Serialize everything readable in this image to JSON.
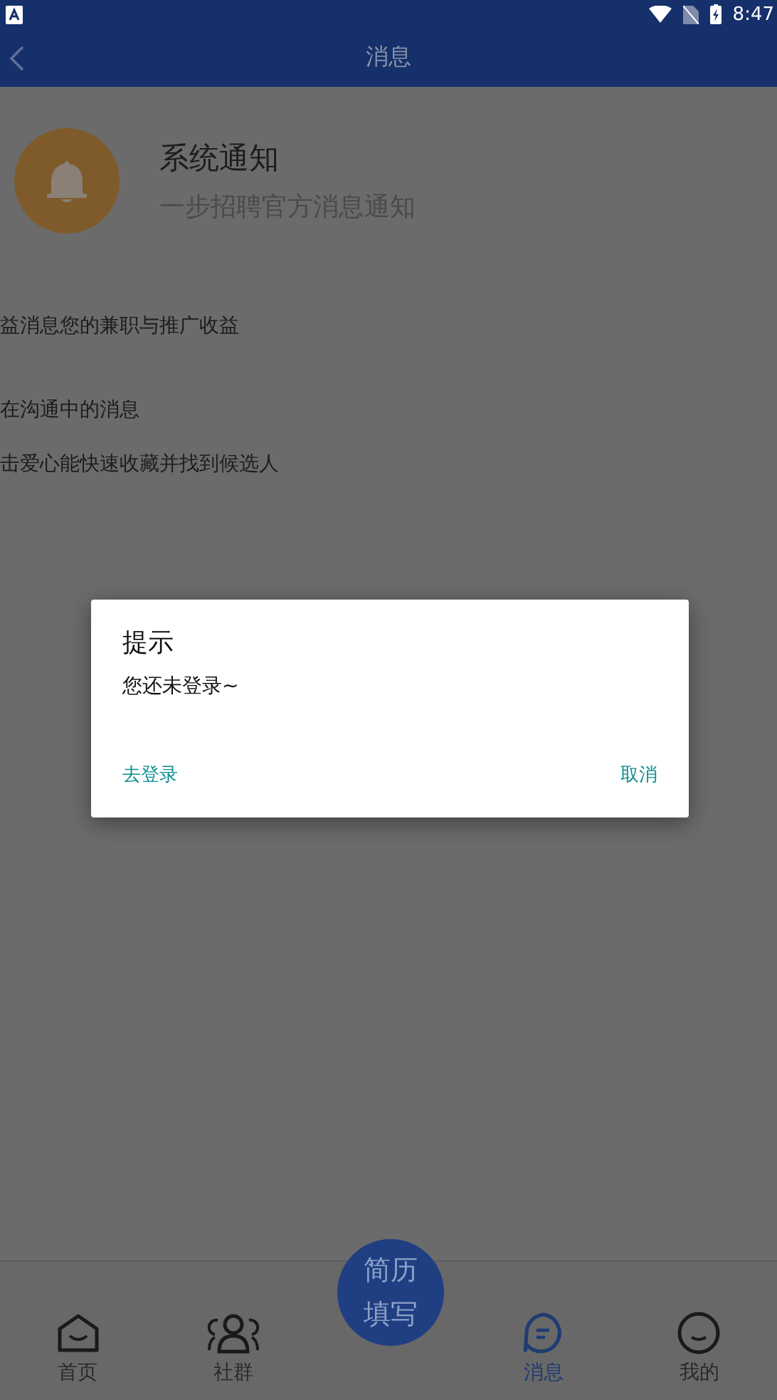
{
  "status_bar": {
    "time": "8:47"
  },
  "header": {
    "title": "消息"
  },
  "system_notice": {
    "title": "系统通知",
    "subtitle": "一步招聘官方消息通知"
  },
  "messages": [
    "益消息您的兼职与推广收益",
    "在沟通中的消息",
    "击爱心能快速收藏并找到候选人"
  ],
  "dialog": {
    "title": "提示",
    "message": "您还未登录~",
    "confirm": "去登录",
    "cancel": "取消"
  },
  "center_button": {
    "lines": [
      "简历",
      "填写"
    ]
  },
  "nav": [
    {
      "kind": "home",
      "label": "首页",
      "selected": false
    },
    {
      "kind": "group",
      "label": "社群",
      "selected": false
    },
    {
      "kind": "message",
      "label": "消息",
      "selected": true
    },
    {
      "kind": "me",
      "label": "我的",
      "selected": false
    }
  ]
}
